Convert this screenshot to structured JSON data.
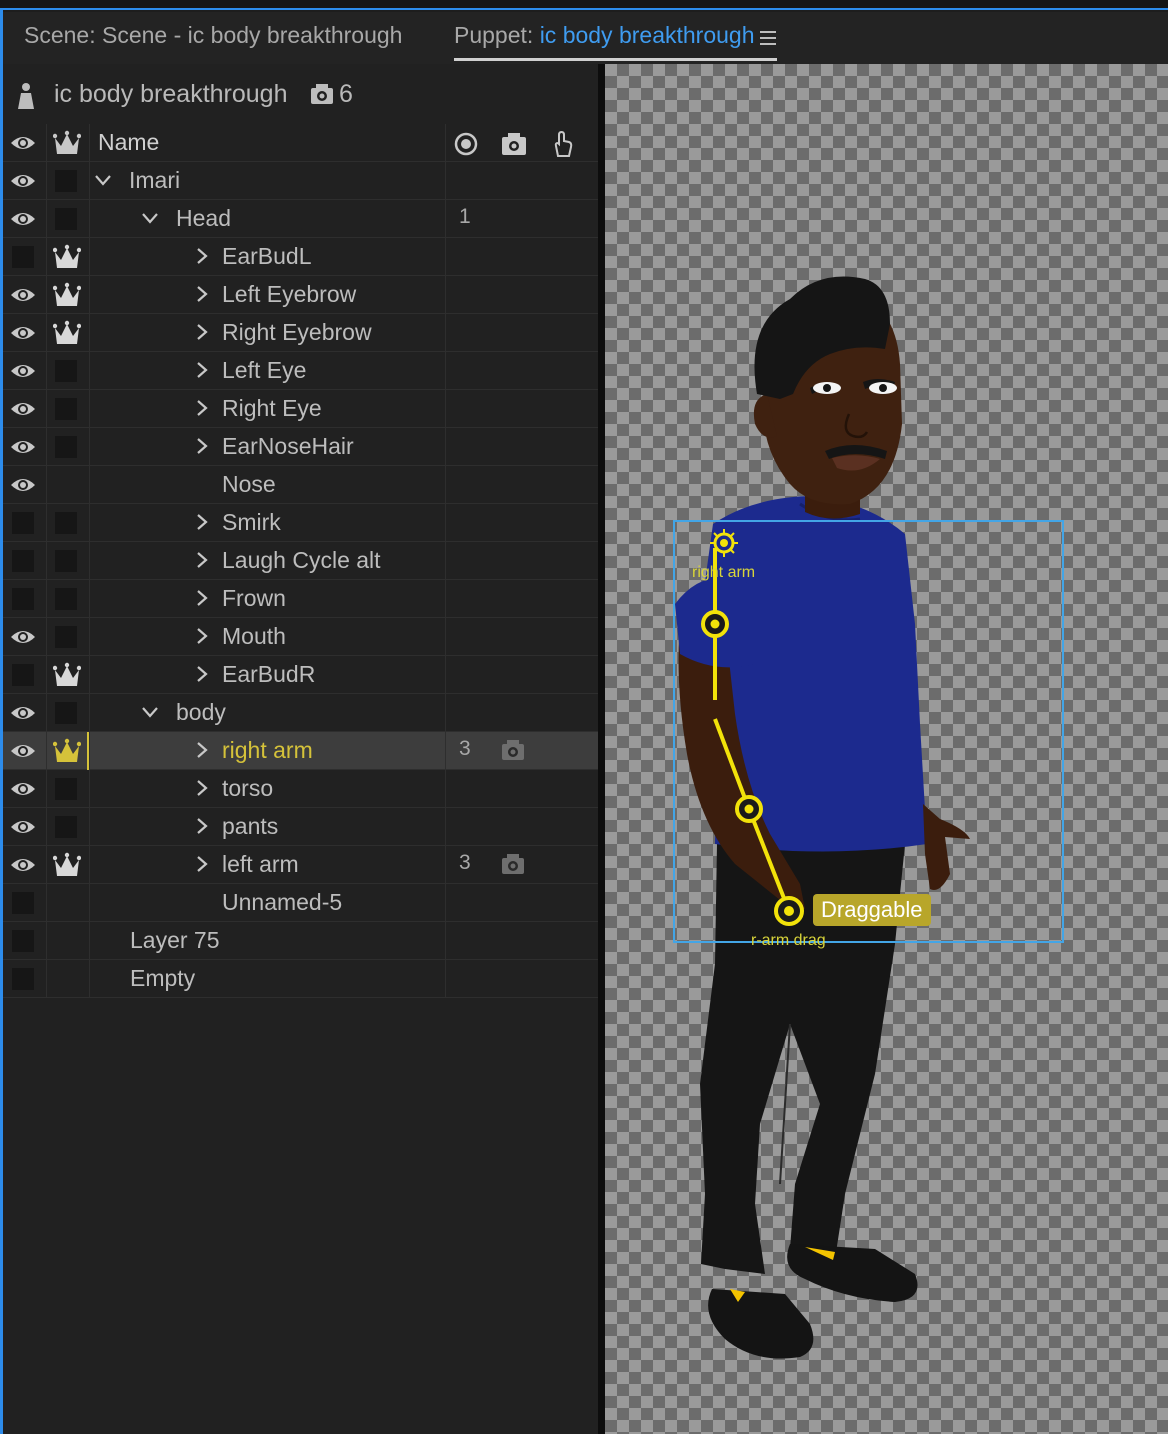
{
  "tabs": {
    "scene": "Scene: Scene - ic body breakthrough",
    "puppet_prefix": "Puppet:",
    "puppet_name": "ic body breakthrough"
  },
  "puppet_panel": {
    "title": "ic body breakthrough",
    "camera_count": "6",
    "column_name": "Name"
  },
  "layers": [
    {
      "name": "Imari",
      "eye": true,
      "crown": "box",
      "chevron": "down",
      "indent": 1,
      "num": "",
      "cam": false
    },
    {
      "name": "Head",
      "eye": true,
      "crown": "box",
      "chevron": "down",
      "indent": 2,
      "num": "1",
      "cam": false
    },
    {
      "name": "EarBudL",
      "eye": false,
      "crown": "icon",
      "chevron": "right",
      "indent": 3,
      "num": "",
      "cam": false
    },
    {
      "name": "Left Eyebrow",
      "eye": true,
      "crown": "icon",
      "chevron": "right",
      "indent": 3,
      "num": "",
      "cam": false
    },
    {
      "name": "Right Eyebrow",
      "eye": true,
      "crown": "icon",
      "chevron": "right",
      "indent": 3,
      "num": "",
      "cam": false
    },
    {
      "name": "Left Eye",
      "eye": true,
      "crown": "box",
      "chevron": "right",
      "indent": 3,
      "num": "",
      "cam": false
    },
    {
      "name": "Right Eye",
      "eye": true,
      "crown": "box",
      "chevron": "right",
      "indent": 3,
      "num": "",
      "cam": false
    },
    {
      "name": "EarNoseHair",
      "eye": true,
      "crown": "box",
      "chevron": "right",
      "indent": 3,
      "num": "",
      "cam": false
    },
    {
      "name": "Nose",
      "eye": true,
      "crown": "none",
      "chevron": "none",
      "indent": 3,
      "num": "",
      "cam": false
    },
    {
      "name": "Smirk",
      "eye": false,
      "crown": "box",
      "chevron": "right",
      "indent": 3,
      "num": "",
      "cam": false
    },
    {
      "name": "Laugh Cycle alt",
      "eye": false,
      "crown": "box",
      "chevron": "right",
      "indent": 3,
      "num": "",
      "cam": false
    },
    {
      "name": "Frown",
      "eye": false,
      "crown": "box",
      "chevron": "right",
      "indent": 3,
      "num": "",
      "cam": false
    },
    {
      "name": "Mouth",
      "eye": true,
      "crown": "box",
      "chevron": "right",
      "indent": 3,
      "num": "",
      "cam": false
    },
    {
      "name": "EarBudR",
      "eye": false,
      "crown": "icon",
      "chevron": "right",
      "indent": 3,
      "num": "",
      "cam": false
    },
    {
      "name": "body",
      "eye": true,
      "crown": "box",
      "chevron": "down",
      "indent": 2,
      "num": "",
      "cam": false
    },
    {
      "name": "right arm",
      "eye": true,
      "crown": "icon-yellow",
      "chevron": "right",
      "indent": 3,
      "num": "3",
      "cam": true,
      "selected": true
    },
    {
      "name": "torso",
      "eye": true,
      "crown": "box",
      "chevron": "right",
      "indent": 3,
      "num": "",
      "cam": false
    },
    {
      "name": "pants",
      "eye": true,
      "crown": "box",
      "chevron": "right",
      "indent": 3,
      "num": "",
      "cam": false
    },
    {
      "name": "left arm",
      "eye": true,
      "crown": "icon",
      "chevron": "right",
      "indent": 3,
      "num": "3",
      "cam": true
    },
    {
      "name": "Unnamed-5",
      "eye": false,
      "crown": "none",
      "chevron": "none",
      "indent": 3,
      "num": "",
      "cam": false
    },
    {
      "name": "Layer 75",
      "eye": false,
      "crown": "none",
      "chevron": "none",
      "indent": 1,
      "num": "",
      "cam": false
    },
    {
      "name": "Empty",
      "eye": false,
      "crown": "none",
      "chevron": "none",
      "indent": 1,
      "num": "",
      "cam": false
    }
  ],
  "stage": {
    "tooltip": "Draggable",
    "bone_label_top": "right arm",
    "bone_label_bottom": "r-arm drag"
  },
  "colors": {
    "accent_blue": "#2d8ceb",
    "handle_yellow": "#f2e20a",
    "selection_yellow": "#d5c23a",
    "shirt": "#1a2a8a",
    "skin": "#3f2110"
  }
}
